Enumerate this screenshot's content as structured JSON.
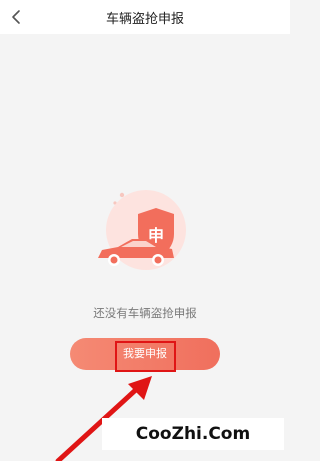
{
  "header": {
    "title": "车辆盗抢申报",
    "back_icon": "chevron-left-icon"
  },
  "illustration": {
    "badge_text": "申",
    "icons": [
      "car-icon",
      "shield-icon"
    ],
    "colors": {
      "circle": "#fde3df",
      "accent": "#f26e5c"
    }
  },
  "empty_state": {
    "message": "还没有车辆盗抢申报"
  },
  "actions": {
    "apply_label": "我要申报"
  },
  "watermark": {
    "text": "CooZhi.Com"
  },
  "colors": {
    "background": "#f4f4f4",
    "button": "#f37a66",
    "highlight": "#e01515"
  }
}
